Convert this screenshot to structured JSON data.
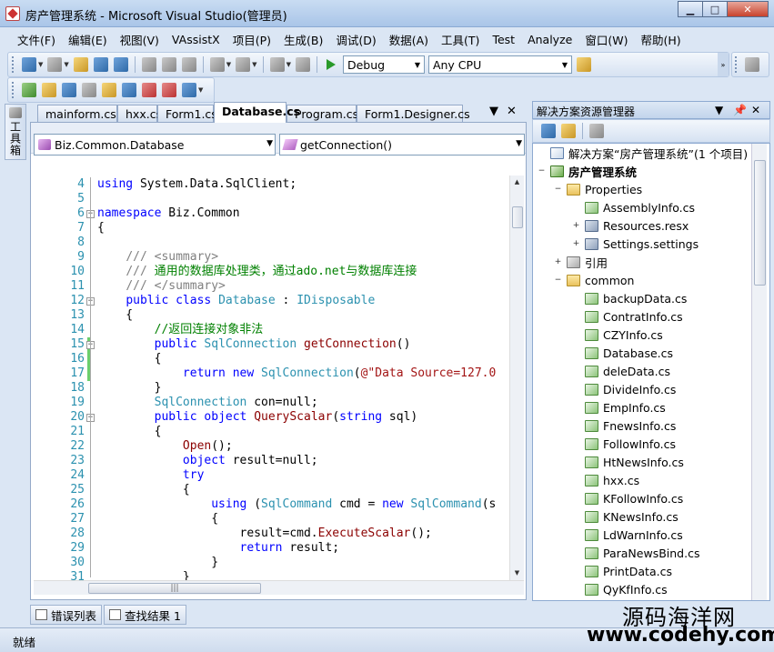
{
  "window": {
    "title": "房产管理系统 - Microsoft Visual Studio(管理员)"
  },
  "menu": [
    "文件(F)",
    "编辑(E)",
    "视图(V)",
    "VAssistX",
    "项目(P)",
    "生成(B)",
    "调试(D)",
    "数据(A)",
    "工具(T)",
    "Test",
    "Analyze",
    "窗口(W)",
    "帮助(H)"
  ],
  "toolbar": {
    "config": "Debug",
    "platform": "Any CPU"
  },
  "toolbox": {
    "label": "工具箱"
  },
  "tabs": [
    "mainform.cs",
    "hxx.cs",
    "Form1.cs",
    "Database.cs",
    "Program.cs",
    "Form1.Designer.cs"
  ],
  "active_tab": "Database.cs",
  "nav": {
    "type_combo": "Biz.Common.Database",
    "member_combo": "getConnection()"
  },
  "code": {
    "lines": [
      {
        "n": "4",
        "t": "using System.Data.SqlClient;"
      },
      {
        "n": "5",
        "t": ""
      },
      {
        "n": "6",
        "t": "namespace Biz.Common"
      },
      {
        "n": "7",
        "t": "{"
      },
      {
        "n": "8",
        "t": ""
      },
      {
        "n": "9",
        "t": "    /// <summary>"
      },
      {
        "n": "10",
        "t": "    /// 通用的数据库处理类，通过ado.net与数据库连接"
      },
      {
        "n": "11",
        "t": "    /// </summary>"
      },
      {
        "n": "12",
        "t": "    public class Database : IDisposable"
      },
      {
        "n": "13",
        "t": "    {"
      },
      {
        "n": "14",
        "t": "        //返回连接对象非法"
      },
      {
        "n": "15",
        "t": "        public SqlConnection getConnection()"
      },
      {
        "n": "16",
        "t": "        {"
      },
      {
        "n": "17",
        "t": "            return new SqlConnection(@\"Data Source=127.0"
      },
      {
        "n": "18",
        "t": "        }"
      },
      {
        "n": "19",
        "t": "        SqlConnection con=null;"
      },
      {
        "n": "20",
        "t": "        public object QueryScalar(string sql)"
      },
      {
        "n": "21",
        "t": "        {"
      },
      {
        "n": "22",
        "t": "            Open();"
      },
      {
        "n": "23",
        "t": "            object result=null;"
      },
      {
        "n": "24",
        "t": "            try"
      },
      {
        "n": "25",
        "t": "            {"
      },
      {
        "n": "26",
        "t": "                using (SqlCommand cmd = new SqlCommand(s"
      },
      {
        "n": "27",
        "t": "                {"
      },
      {
        "n": "28",
        "t": "                    result=cmd.ExecuteScalar();"
      },
      {
        "n": "29",
        "t": "                    return result;"
      },
      {
        "n": "30",
        "t": "                }"
      },
      {
        "n": "31",
        "t": "            }"
      }
    ]
  },
  "solution_explorer": {
    "title": "解决方案资源管理器",
    "nodes": [
      {
        "label": "解决方案“房产管理系统”(1 个项目)",
        "icon": "sln",
        "expander": ""
      },
      {
        "label": "房产管理系统",
        "icon": "proj",
        "expander": "−"
      },
      {
        "label": "Properties",
        "icon": "folder",
        "expander": "−"
      },
      {
        "label": "AssemblyInfo.cs",
        "icon": "cs",
        "expander": ""
      },
      {
        "label": "Resources.resx",
        "icon": "resx",
        "expander": "+"
      },
      {
        "label": "Settings.settings",
        "icon": "resx",
        "expander": "+"
      },
      {
        "label": "引用",
        "icon": "ref",
        "expander": "+"
      },
      {
        "label": "common",
        "icon": "folder",
        "expander": "−"
      },
      {
        "label": "backupData.cs",
        "icon": "cs",
        "expander": ""
      },
      {
        "label": "ContratInfo.cs",
        "icon": "cs",
        "expander": ""
      },
      {
        "label": "CZYInfo.cs",
        "icon": "cs",
        "expander": ""
      },
      {
        "label": "Database.cs",
        "icon": "cs",
        "expander": ""
      },
      {
        "label": "deleData.cs",
        "icon": "cs",
        "expander": ""
      },
      {
        "label": "DivideInfo.cs",
        "icon": "cs",
        "expander": ""
      },
      {
        "label": "EmpInfo.cs",
        "icon": "cs",
        "expander": ""
      },
      {
        "label": "FnewsInfo.cs",
        "icon": "cs",
        "expander": ""
      },
      {
        "label": "FollowInfo.cs",
        "icon": "cs",
        "expander": ""
      },
      {
        "label": "HtNewsInfo.cs",
        "icon": "cs",
        "expander": ""
      },
      {
        "label": "hxx.cs",
        "icon": "cs",
        "expander": ""
      },
      {
        "label": "KFollowInfo.cs",
        "icon": "cs",
        "expander": ""
      },
      {
        "label": "KNewsInfo.cs",
        "icon": "cs",
        "expander": ""
      },
      {
        "label": "LdWarnInfo.cs",
        "icon": "cs",
        "expander": ""
      },
      {
        "label": "ParaNewsBind.cs",
        "icon": "cs",
        "expander": ""
      },
      {
        "label": "PrintData.cs",
        "icon": "cs",
        "expander": ""
      },
      {
        "label": "QyKfInfo.cs",
        "icon": "cs",
        "expander": ""
      }
    ]
  },
  "bottom_tabs": [
    "错误列表",
    "查找结果 1"
  ],
  "status": "就绪",
  "watermark": {
    "cn": "源码海洋网",
    "url": "www.codehy.com"
  }
}
